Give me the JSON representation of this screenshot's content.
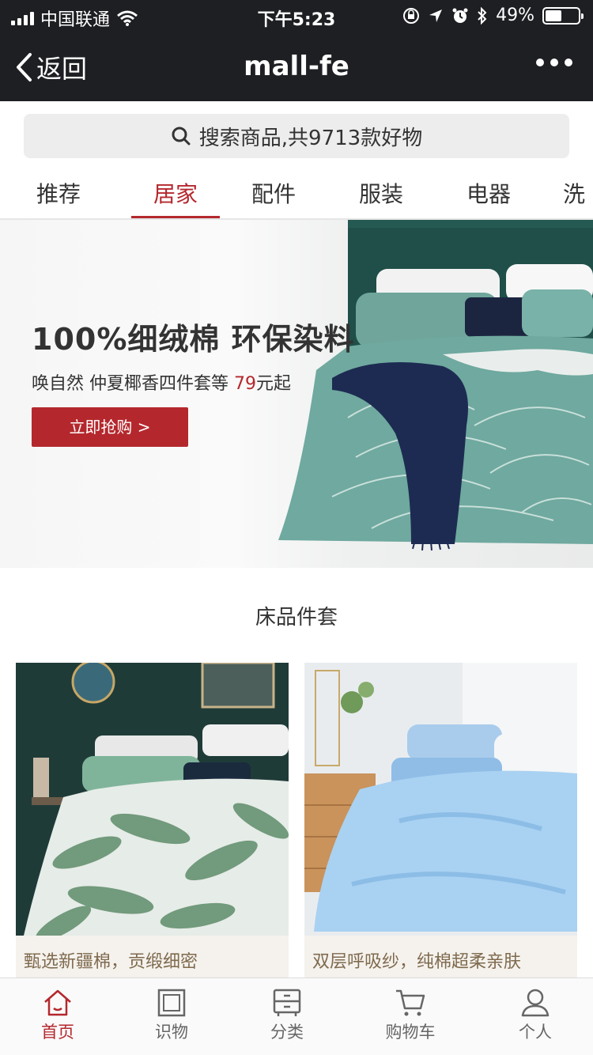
{
  "status_bar": {
    "carrier": "中国联通",
    "time": "下午5:23",
    "battery": "49%",
    "battery_level": 0.49
  },
  "nav": {
    "back_label": "返回",
    "title": "mall-fe"
  },
  "search": {
    "placeholder": "搜索商品,共9713款好物"
  },
  "tabs": [
    {
      "label": "推荐"
    },
    {
      "label": "居家",
      "active": true
    },
    {
      "label": "配件"
    },
    {
      "label": "服装"
    },
    {
      "label": "电器"
    },
    {
      "label": "洗"
    }
  ],
  "banner": {
    "headline": "100%细绒棉 环保染料",
    "subtitle_prefix": "唤自然 仲夏椰香四件套等 ",
    "price": "79",
    "subtitle_suffix": "元起",
    "button_label": "立即抢购 >"
  },
  "section": {
    "title": "床品件套"
  },
  "products": [
    {
      "name": "甄选新疆棉，贡缎细密"
    },
    {
      "name": "双层呼吸纱，纯棉超柔亲肤"
    }
  ],
  "tabbar": [
    {
      "label": "首页",
      "icon": "home-icon",
      "active": true
    },
    {
      "label": "识物",
      "icon": "square-icon"
    },
    {
      "label": "分类",
      "icon": "category-icon"
    },
    {
      "label": "购物车",
      "icon": "cart-icon"
    },
    {
      "label": "个人",
      "icon": "user-icon"
    }
  ],
  "colors": {
    "accent": "#b4282d",
    "header_bg": "#1e1f23",
    "product_name": "#7f6a4e"
  }
}
